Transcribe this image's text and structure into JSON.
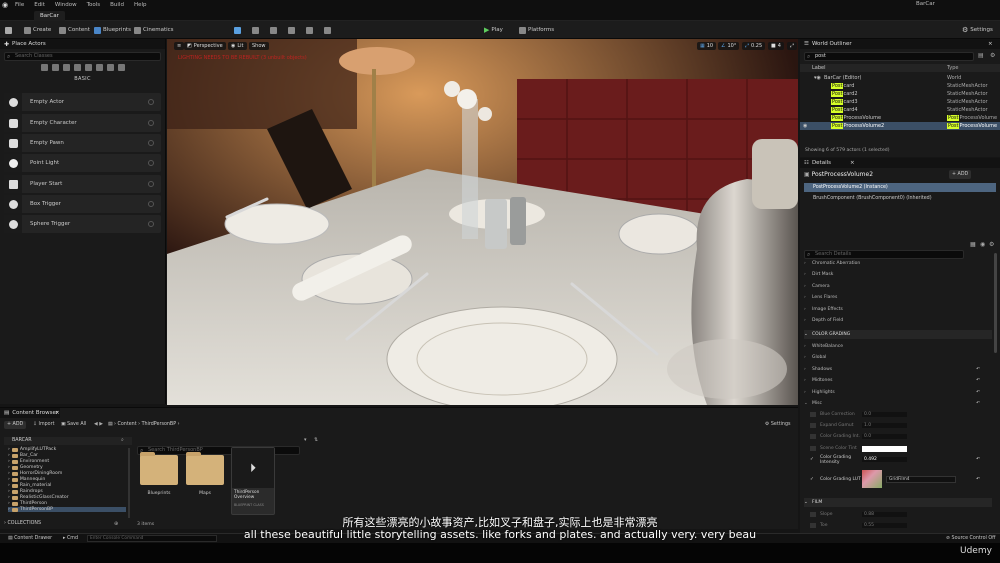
{
  "menubar": {
    "items": [
      "File",
      "Edit",
      "Window",
      "Tools",
      "Build",
      "Help"
    ],
    "project": "BarCar"
  },
  "tab": {
    "label": "BarCar"
  },
  "toolbar": {
    "create": "Create",
    "content": "Content",
    "blueprints": "Blueprints",
    "cinematics": "Cinematics",
    "play": "Play",
    "platforms": "Platforms",
    "settings": "Settings"
  },
  "place_actors": {
    "title": "Place Actors",
    "search_placeholder": "Search Classes",
    "category": "BASIC",
    "items": [
      "Empty Actor",
      "Empty Character",
      "Empty Pawn",
      "Point Light",
      "Player Start",
      "Box Trigger",
      "Sphere Trigger"
    ]
  },
  "viewport": {
    "perspective": "Perspective",
    "lit": "Lit",
    "show": "Show",
    "warning": "LIGHTING NEEDS TO BE REBUILT (3 unbuilt objects)",
    "snap_grid": "10",
    "snap_rot": "10°",
    "snap_scale": "0.25",
    "cam_speed": "4"
  },
  "outliner": {
    "title": "World Outliner",
    "search_value": "post",
    "col_label": "Label",
    "col_type": "Type",
    "rows": [
      {
        "pre": "",
        "match": "",
        "post": "BarCar (Editor)",
        "type": "World"
      },
      {
        "pre": "",
        "match": "Post",
        "post": "card",
        "type": "StaticMeshActor"
      },
      {
        "pre": "",
        "match": "Post",
        "post": "card2",
        "type": "StaticMeshActor"
      },
      {
        "pre": "",
        "match": "Post",
        "post": "card3",
        "type": "StaticMeshActor"
      },
      {
        "pre": "",
        "match": "Post",
        "post": "card4",
        "type": "StaticMeshActor"
      },
      {
        "pre": "",
        "match": "Post",
        "post": "ProcessVolume",
        "type_pre": "",
        "type_match": "Post",
        "type_post": "ProcessVolume"
      },
      {
        "pre": "",
        "match": "Post",
        "post": "ProcessVolume2",
        "type_pre": "",
        "type_match": "Post",
        "type_post": "ProcessVolume"
      }
    ],
    "status": "Showing 6 of 579 actors (1 selected)"
  },
  "details": {
    "title": "Details",
    "actor_name": "PostProcessVolume2",
    "add_label": "+ ADD",
    "instance": "PostProcessVolume2 (Instance)",
    "component": "BrushComponent (BrushComponent0) (Inherited)",
    "search_placeholder": "Search Details",
    "rows_top": [
      "Chromatic Aberration",
      "Dirt Mask",
      "Camera",
      "Lens Flares",
      "Image Effects",
      "Depth of Field"
    ],
    "section_color": "COLOR GRADING",
    "rows_color": [
      "WhiteBalance",
      "Global",
      "Shadows",
      "Midtones",
      "Highlights",
      "Misc"
    ],
    "misc": [
      {
        "label": "Blue Correction",
        "value": "0.0"
      },
      {
        "label": "Expand Gamut",
        "value": "1.0"
      },
      {
        "label": "Color Grading Int.",
        "value": "0.0"
      },
      {
        "label": "Scene Color Tint",
        "value": ""
      },
      {
        "label": "Color Grading Intensity",
        "value": "0.492"
      },
      {
        "label": "Color Grading LUT",
        "value": "GridFilm4"
      }
    ],
    "section_film": "FILM",
    "film": [
      {
        "label": "Slope",
        "value": "0.88"
      },
      {
        "label": "Toe",
        "value": "0.55"
      }
    ]
  },
  "content_browser": {
    "title": "Content Browser",
    "add": "+ ADD",
    "import": "Import",
    "save_all": "Save All",
    "path": [
      "Content",
      "ThirdPersonBP"
    ],
    "settings": "Settings",
    "root": "BARCAR",
    "search_placeholder": "Search ThirdPersonBP",
    "tree": [
      "AmplifyLUTPack",
      "Bar_Car",
      "Environment",
      "Geometry",
      "HorrorDiningRoom",
      "Mannequin",
      "Rain_material",
      "Raindrops",
      "RealisticGlassCreator",
      "ThirdPerson",
      "ThirdPersonBP"
    ],
    "assets": [
      {
        "name": "Blueprints"
      },
      {
        "name": "Maps"
      },
      {
        "name": "ThirdPerson Overview",
        "kind": "BLUEPRINT CLASS"
      }
    ],
    "items_count": "3 items",
    "collections": "COLLECTIONS"
  },
  "statusbar": {
    "content_drawer": "Content Drawer",
    "cmd": "Cmd",
    "console_placeholder": "Enter Console Command",
    "source_control": "Source Control Off"
  },
  "subtitles": {
    "zh": "所有这些漂亮的小故事资产,比如叉子和盘子,实际上也是非常漂亮",
    "en": "all these beautiful little storytelling assets. like forks and plates. and actually very. very beau"
  },
  "watermark": "Udemy"
}
